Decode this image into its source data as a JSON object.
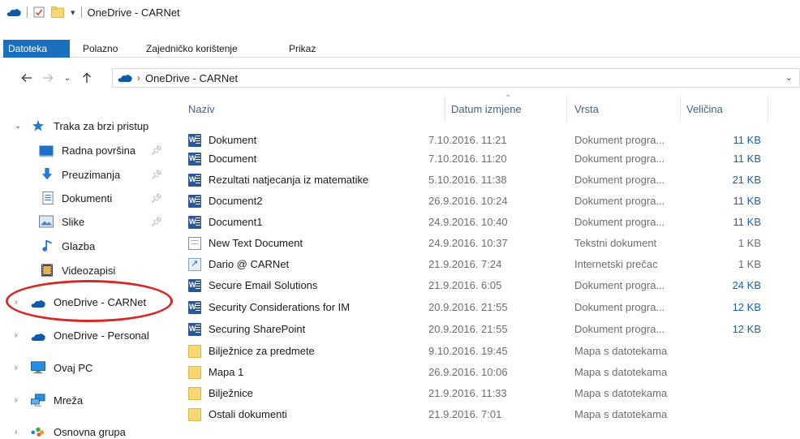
{
  "window": {
    "title": "OneDrive - CARNet"
  },
  "ribbon": {
    "tabs": [
      "Datoteka",
      "Polazno",
      "Zajedničko korištenje",
      "Prikaz"
    ]
  },
  "address": {
    "breadcrumb": "OneDrive - CARNet"
  },
  "nav": {
    "quick_access": "Traka za brzi pristup",
    "items": [
      {
        "label": "Radna površina",
        "icon": "desktop-icon",
        "pinned": true
      },
      {
        "label": "Preuzimanja",
        "icon": "download-icon",
        "pinned": true
      },
      {
        "label": "Dokumenti",
        "icon": "documents-icon",
        "pinned": true
      },
      {
        "label": "Slike",
        "icon": "pictures-icon",
        "pinned": true
      },
      {
        "label": "Glazba",
        "icon": "music-icon",
        "pinned": false
      },
      {
        "label": "Videozapisi",
        "icon": "video-icon",
        "pinned": false
      }
    ],
    "onedrive_carnet": "OneDrive - CARNet",
    "onedrive_personal": "OneDrive - Personal",
    "this_pc": "Ovaj PC",
    "network": "Mreža",
    "homegroup": "Osnovna grupa"
  },
  "columns": {
    "name": "Naziv",
    "date": "Datum izmjene",
    "type": "Vrsta",
    "size": "Veličina"
  },
  "files": [
    {
      "name": "Dokument",
      "date": "7.10.2016. 11:21",
      "type": "Dokument progra...",
      "size": "11 KB",
      "icon": "word"
    },
    {
      "name": "Document",
      "date": "7.10.2016. 11:20",
      "type": "Dokument progra...",
      "size": "11 KB",
      "icon": "word"
    },
    {
      "name": "Rezultati natjecanja iz matematike",
      "date": "5.10.2016. 11:38",
      "type": "Dokument progra...",
      "size": "21 KB",
      "icon": "word"
    },
    {
      "name": "Document2",
      "date": "26.9.2016. 10:24",
      "type": "Dokument progra...",
      "size": "11 KB",
      "icon": "word"
    },
    {
      "name": "Document1",
      "date": "24.9.2016. 10:40",
      "type": "Dokument progra...",
      "size": "11 KB",
      "icon": "word"
    },
    {
      "name": "New Text Document",
      "date": "24.9.2016. 10:37",
      "type": "Tekstni dokument",
      "size": "1 KB",
      "icon": "text"
    },
    {
      "name": "Dario @ CARNet",
      "date": "21.9.2016. 7:24",
      "type": "Internetski prečac",
      "size": "1 KB",
      "icon": "link"
    },
    {
      "name": "Secure Email Solutions",
      "date": "21.9.2016. 6:05",
      "type": "Dokument progra...",
      "size": "24 KB",
      "icon": "word"
    },
    {
      "name": "Security Considerations for IM",
      "date": "20.9.2016. 21:55",
      "type": "Dokument progra...",
      "size": "12 KB",
      "icon": "word"
    },
    {
      "name": "Securing SharePoint",
      "date": "20.9.2016. 21:55",
      "type": "Dokument progra...",
      "size": "12 KB",
      "icon": "word"
    },
    {
      "name": "Bilježnice za predmete",
      "date": "9.10.2016. 19:45",
      "type": "Mapa s datotekama",
      "size": "",
      "icon": "folder"
    },
    {
      "name": "Mapa 1",
      "date": "26.9.2016. 10:06",
      "type": "Mapa s datotekama",
      "size": "",
      "icon": "folder"
    },
    {
      "name": "Bilježnice",
      "date": "21.9.2016. 11:33",
      "type": "Mapa s datotekama",
      "size": "",
      "icon": "folder"
    },
    {
      "name": "Ostali dokumenti",
      "date": "21.9.2016. 7:01",
      "type": "Mapa s datotekama",
      "size": "",
      "icon": "folder"
    }
  ],
  "colors": {
    "accent": "#1a6fbf",
    "highlight_oval": "#d52a2a",
    "word": "#2b579a",
    "folder": "#f7d774"
  }
}
